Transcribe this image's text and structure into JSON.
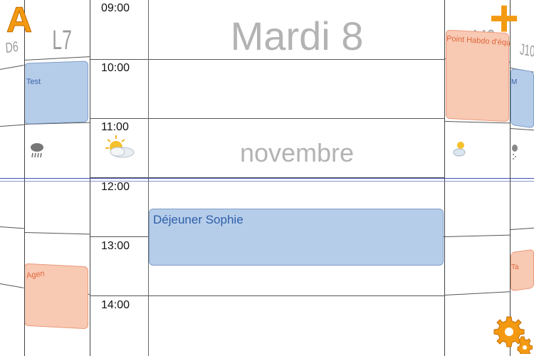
{
  "header": {
    "day_title": "Mardi 8",
    "month_title": "novembre",
    "left_day_1": "D6",
    "left_day_2": "L7",
    "right_day_1": "M9",
    "right_day_2": "J10"
  },
  "times": [
    "09:00",
    "10:00",
    "11:00",
    "12:00",
    "13:00",
    "14:00"
  ],
  "events": {
    "main": "Déjeuner Sophie",
    "left_test": "Test",
    "left_agen": "Agen",
    "right_point": "Point Habdo d'équipe",
    "right_m": "M",
    "right_ta": "Ta"
  },
  "buttons": {
    "app_logo": "A",
    "add": "+"
  },
  "icons": {
    "weather_main": "partly-cloudy-icon",
    "weather_left": "rain-cloud-icon",
    "weather_right": "partly-cloudy-icon",
    "weather_far_right": "snow-cloud-icon",
    "settings": "gear-icon"
  },
  "colors": {
    "event_blue": "#b6cdea",
    "event_orange": "#f8c9b3",
    "accent_orange": "#f39a12",
    "title_gray": "#b3b3b3",
    "now_line": "#3e4eb5"
  }
}
